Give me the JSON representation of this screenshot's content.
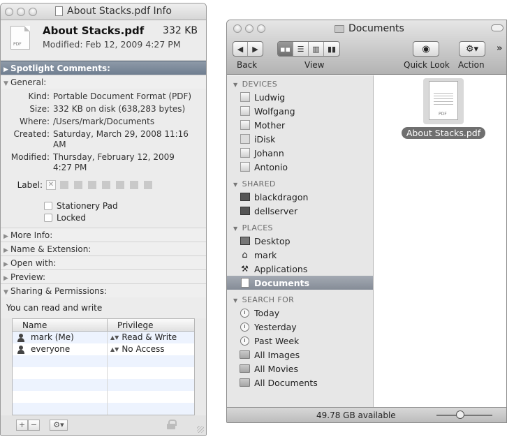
{
  "info_window": {
    "title": "About Stacks.pdf Info",
    "file_name": "About Stacks.pdf",
    "file_size": "332 KB",
    "modified_line": "Modified: Feb 12, 2009 4:27 PM",
    "icon_label": "PDF",
    "spotlight_label": "Spotlight Comments:",
    "general_label": "General:",
    "general": [
      {
        "key": "Kind:",
        "value": "Portable Document Format (PDF)"
      },
      {
        "key": "Size:",
        "value": "332 KB on disk (638,283 bytes)"
      },
      {
        "key": "Where:",
        "value": "/Users/mark/Documents"
      },
      {
        "key": "Created:",
        "value": "Saturday, March 29, 2008 11:16 AM"
      },
      {
        "key": "Modified:",
        "value": "Thursday, February 12, 2009 4:27 PM"
      }
    ],
    "label_key": "Label:",
    "stationery": "Stationery Pad",
    "locked": "Locked",
    "sections": [
      "More Info:",
      "Name & Extension:",
      "Open with:",
      "Preview:"
    ],
    "sharing_label": "Sharing & Permissions:",
    "sharing_text": "You can read and write",
    "perm_headers": {
      "name": "Name",
      "privilege": "Privilege"
    },
    "perm_rows": [
      {
        "name": "mark (Me)",
        "privilege": "Read & Write"
      },
      {
        "name": "everyone",
        "privilege": "No Access"
      }
    ],
    "footer": {
      "add": "+",
      "remove": "−",
      "action": "⚙▾"
    }
  },
  "finder": {
    "title": "Documents",
    "toolbar": {
      "back": "Back",
      "view": "View",
      "quicklook": "Quick Look",
      "action": "Action",
      "more": "»"
    },
    "sections": [
      {
        "name": "DEVICES",
        "items": [
          {
            "label": "Ludwig",
            "icon": "disk-icon"
          },
          {
            "label": "Wolfgang",
            "icon": "disk-icon"
          },
          {
            "label": "Mother",
            "icon": "disk-icon"
          },
          {
            "label": "iDisk",
            "icon": "idisk-icon"
          },
          {
            "label": "Johann",
            "icon": "disk-icon"
          },
          {
            "label": "Antonio",
            "icon": "disk-icon"
          }
        ]
      },
      {
        "name": "SHARED",
        "items": [
          {
            "label": "blackdragon",
            "icon": "monitor-icon"
          },
          {
            "label": "dellserver",
            "icon": "monitor-icon"
          }
        ]
      },
      {
        "name": "PLACES",
        "items": [
          {
            "label": "Desktop",
            "icon": "desktop-icon"
          },
          {
            "label": "mark",
            "icon": "home-icon"
          },
          {
            "label": "Applications",
            "icon": "applications-icon"
          },
          {
            "label": "Documents",
            "icon": "document-icon"
          }
        ]
      },
      {
        "name": "SEARCH FOR",
        "items": [
          {
            "label": "Today",
            "icon": "clock-icon"
          },
          {
            "label": "Yesterday",
            "icon": "clock-icon"
          },
          {
            "label": "Past Week",
            "icon": "clock-icon"
          },
          {
            "label": "All Images",
            "icon": "smart-folder-icon"
          },
          {
            "label": "All Movies",
            "icon": "smart-folder-icon"
          },
          {
            "label": "All Documents",
            "icon": "smart-folder-icon"
          }
        ]
      }
    ],
    "file": {
      "name": "About Stacks.pdf",
      "icon_label": "PDF"
    },
    "status": "49.78 GB available"
  }
}
